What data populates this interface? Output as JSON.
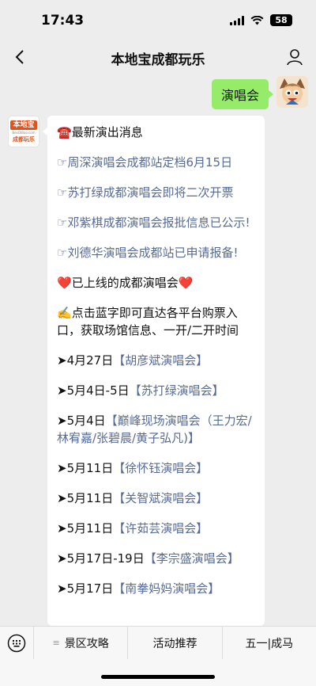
{
  "status": {
    "time": "17:43",
    "battery": "58"
  },
  "nav": {
    "title": "本地宝成都玩乐"
  },
  "user_message": {
    "text": "演唱会"
  },
  "bot_avatar": {
    "logo_text": "本地宝",
    "logo_sub": "BenDiBao.com",
    "city": "成都玩乐"
  },
  "bot_message": {
    "header_icon": "☎️",
    "header": "最新演出消息",
    "news": [
      "☞周深演唱会成都站定档6月15日",
      "☞苏打绿成都演唱会即将二次开票",
      "☞邓紫棋成都演唱会报批信息已公示!",
      "☞刘德华演唱会成都站已申请报备!"
    ],
    "heart": "❤️",
    "online_title": "已上线的成都演唱会",
    "hint_icon": "✍️",
    "hint": "点击蓝字即可直达各平台购票入口，获取场馆信息、一开/二开时间",
    "concerts": [
      {
        "date": "➤4月27日",
        "name": "【胡彦斌演唱会】"
      },
      {
        "date": "➤5月4日-5日",
        "name": "【苏打绿演唱会】"
      },
      {
        "date": "➤5月4日",
        "name": "【巅峰现场演唱会（王力宏/林宥嘉/张碧晨/黄子弘凡)】"
      },
      {
        "date": "➤5月11日",
        "name": "【徐怀钰演唱会】"
      },
      {
        "date": "➤5月11日",
        "name": "【关智斌演唱会】"
      },
      {
        "date": "➤5月11日",
        "name": "【许茹芸演唱会】"
      },
      {
        "date": "➤5月17日-19日",
        "name": "【李宗盛演唱会】"
      },
      {
        "date": "➤5月17日",
        "name": "【南拳妈妈演唱会】"
      }
    ]
  },
  "bottom_menu": {
    "items": [
      {
        "dots": "≡",
        "label": "景区攻略"
      },
      {
        "dots": "",
        "label": "活动推荐"
      },
      {
        "dots": "",
        "label": "五一|成马"
      }
    ]
  },
  "colors": {
    "bubble_green": "#95ec69",
    "link": "#576b95",
    "background": "#ededed"
  }
}
